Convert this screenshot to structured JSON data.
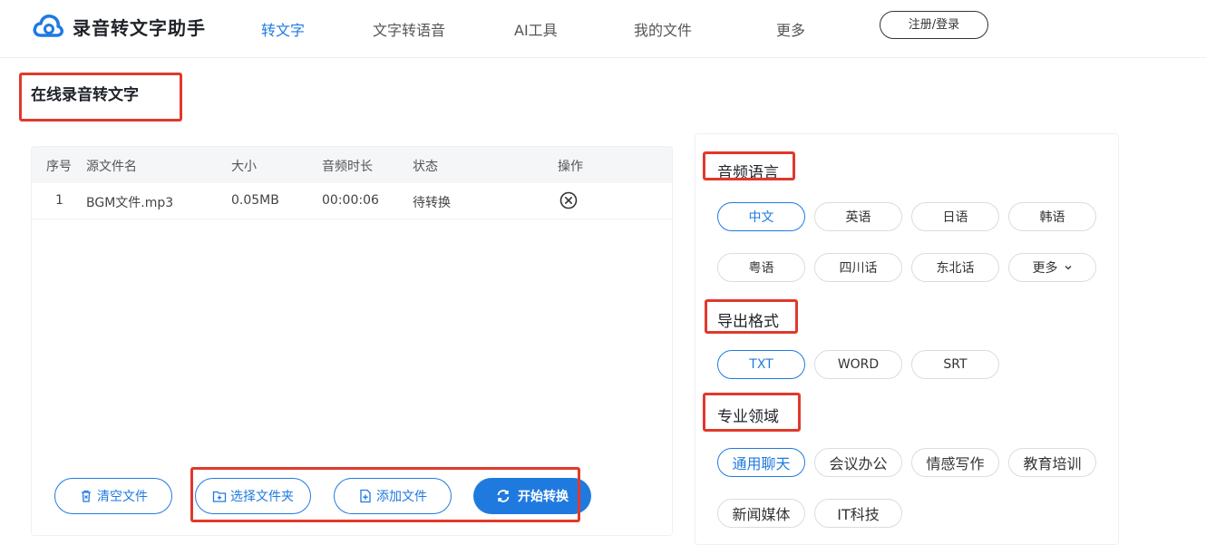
{
  "header": {
    "app_name": "录音转文字助手",
    "nav": [
      "转文字",
      "文字转语音",
      "AI工具",
      "我的文件",
      "更多"
    ],
    "login_label": "注册/登录"
  },
  "page": {
    "title": "在线录音转文字"
  },
  "table": {
    "columns": [
      "序号",
      "源文件名",
      "大小",
      "音频时长",
      "状态",
      "操作"
    ],
    "rows": [
      {
        "index": "1",
        "filename": "BGM文件.mp3",
        "size": "0.05MB",
        "duration": "00:00:06",
        "status": "待转换"
      }
    ]
  },
  "actions": {
    "clear": "清空文件",
    "select_folder": "选择文件夹",
    "add_file": "添加文件",
    "start": "开始转换"
  },
  "settings": {
    "language_title": "音频语言",
    "languages": [
      "中文",
      "英语",
      "日语",
      "韩语",
      "粤语",
      "四川话",
      "东北话",
      "更多"
    ],
    "format_title": "导出格式",
    "formats": [
      "TXT",
      "WORD",
      "SRT"
    ],
    "domain_title": "专业领域",
    "domains": [
      "通用聊天",
      "会议办公",
      "情感写作",
      "教育培训",
      "新闻媒体",
      "IT科技"
    ]
  },
  "colors": {
    "accent": "#1f7ae0",
    "highlight": "#e0392b"
  }
}
